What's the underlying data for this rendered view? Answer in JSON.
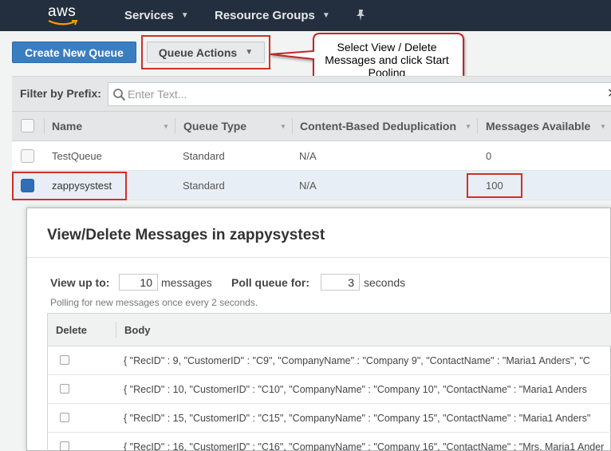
{
  "nav": {
    "logo": "aws",
    "services": "Services",
    "resource_groups": "Resource Groups"
  },
  "toolbar": {
    "create_queue": "Create New Queue",
    "queue_actions": "Queue Actions"
  },
  "callout": {
    "text": "Select View / Delete Messages and click Start Pooling"
  },
  "filter": {
    "label": "Filter by Prefix:",
    "placeholder": "Enter Text..."
  },
  "table": {
    "columns": [
      "Name",
      "Queue Type",
      "Content-Based Deduplication",
      "Messages Available"
    ],
    "rows": [
      {
        "name": "TestQueue",
        "type": "Standard",
        "dedup": "N/A",
        "available": "0",
        "selected": false
      },
      {
        "name": "zappysystest",
        "type": "Standard",
        "dedup": "N/A",
        "available": "100",
        "selected": true
      }
    ]
  },
  "modal": {
    "title": "View/Delete Messages in zappysystest",
    "view_up_to_label": "View up to:",
    "view_up_to_value": "10",
    "messages_label": "messages",
    "poll_label": "Poll queue for:",
    "poll_value": "3",
    "seconds_label": "seconds",
    "hint": "Polling for new messages once every 2 seconds.",
    "columns": {
      "delete": "Delete",
      "body": "Body"
    },
    "messages": [
      "{ \"RecID\" : 9, \"CustomerID\" : \"C9\", \"CompanyName\" : \"Company 9\", \"ContactName\" : \"Maria1 Anders\", \"C",
      "{ \"RecID\" : 10, \"CustomerID\" : \"C10\", \"CompanyName\" : \"Company 10\", \"ContactName\" : \"Maria1 Anders",
      "{ \"RecID\" : 15, \"CustomerID\" : \"C15\", \"CompanyName\" : \"Company 15\", \"ContactName\" : \"Maria1 Anders\"",
      "{ \"RecID\" : 16, \"CustomerID\" : \"C16\", \"CompanyName\" : \"Company 16\", \"ContactName\" : \"Mrs. Maria1 Ander"
    ]
  },
  "colors": {
    "nav_bg": "#232f3e",
    "primary": "#3a7ec2",
    "highlight": "#d0302a"
  }
}
